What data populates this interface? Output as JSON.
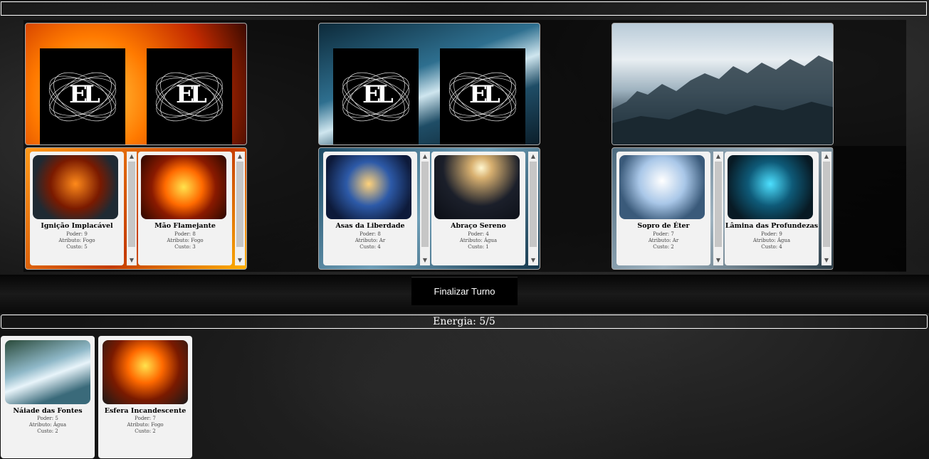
{
  "energy": {
    "label": "Energia: 5/5"
  },
  "end_turn": {
    "label": "Finalizar Turno"
  },
  "locations": [
    {
      "theme": "fire",
      "hidden_cards": 2,
      "logo_text": "EL"
    },
    {
      "theme": "water",
      "hidden_cards": 2,
      "logo_text": "EL"
    },
    {
      "theme": "mist",
      "hidden_cards": 0,
      "logo_text": ""
    }
  ],
  "lanes": [
    {
      "cards": [
        {
          "name": "Ignição Implacável",
          "power": "Poder: 9",
          "attribute": "Atributo: Fogo",
          "cost": "Custo: 5",
          "art": "fire-demon"
        },
        {
          "name": "Mão Flamejante",
          "power": "Poder: 8",
          "attribute": "Atributo: Fogo",
          "cost": "Custo: 3",
          "art": "fire-mandala"
        }
      ]
    },
    {
      "cards": [
        {
          "name": "Asas da Liberdade",
          "power": "Poder: 8",
          "attribute": "Atributo: Ar",
          "cost": "Custo: 4",
          "art": "winged-figure"
        },
        {
          "name": "Abraço Sereno",
          "power": "Poder: 4",
          "attribute": "Atributo: Água",
          "cost": "Custo: 1",
          "art": "embrace-moon"
        }
      ]
    },
    {
      "cards": [
        {
          "name": "Sopro de Éter",
          "power": "Poder: 7",
          "attribute": "Atributo: Ar",
          "cost": "Custo: 2",
          "art": "white-angel"
        },
        {
          "name": "Lâmina das Profundezas",
          "power": "Poder: 9",
          "attribute": "Atributo: Água",
          "cost": "Custo: 4",
          "art": "sea-warrior"
        }
      ]
    }
  ],
  "hand": [
    {
      "name": "Náiade das Fontes",
      "power": "Poder: 5",
      "attribute": "Atributo: Água",
      "cost": "Custo: 2",
      "art": "naiad-waterfall"
    },
    {
      "name": "Esfera Incandescente",
      "power": "Poder: 7",
      "attribute": "Atributo: Fogo",
      "cost": "Custo: 2",
      "art": "fire-bowl"
    }
  ]
}
